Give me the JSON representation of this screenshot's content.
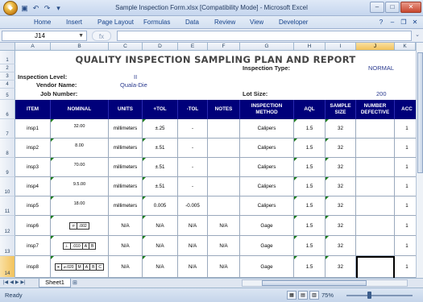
{
  "window": {
    "title": "Sample Inspection Form.xlsx  [Compatibility Mode] - Microsoft Excel"
  },
  "ribbon": {
    "tabs": [
      "Home",
      "Insert",
      "Page Layout",
      "Formulas",
      "Data",
      "Review",
      "View",
      "Developer"
    ]
  },
  "formula_bar": {
    "name_box": "J14",
    "fx": "fx",
    "content": ""
  },
  "columns": [
    "A",
    "B",
    "C",
    "D",
    "E",
    "F",
    "G",
    "H",
    "I",
    "J",
    "K"
  ],
  "selected_column": "J",
  "rows": [
    "1",
    "2",
    "3",
    "4",
    "5",
    "6",
    "7",
    "8",
    "9",
    "10",
    "11",
    "12",
    "13",
    "14"
  ],
  "form": {
    "title": "QUALITY INSPECTION SAMPLING PLAN AND REPORT",
    "inspection_type_label": "Inspection Type:",
    "inspection_type": "NORMAL",
    "inspection_level_label": "Inspection Level:",
    "inspection_level": "II",
    "vendor_name_label": "Vendor Name:",
    "vendor_name": "Quala-Die",
    "job_number_label": "Job Number:",
    "lot_size_label": "Lot Size:",
    "lot_size": "200"
  },
  "table": {
    "headers": [
      "ITEM",
      "NOMINAL",
      "UNITS",
      "+TOL",
      "-TOL",
      "NOTES",
      "INSPECTION METHOD",
      "AQL",
      "SAMPLE SIZE",
      "NUMBER DEFECTIVE",
      "ACC"
    ],
    "rows": [
      {
        "item": "insp1",
        "nominal": "32.00",
        "units": "millimeters",
        "ptol": "±.25",
        "mtol": "-",
        "notes": "",
        "method": "Calipers",
        "aql": "1.5",
        "sample": "32",
        "defective": "",
        "acc": "1"
      },
      {
        "item": "insp2",
        "nominal": "8.00",
        "units": "millimeters",
        "ptol": "±.51",
        "mtol": "-",
        "notes": "",
        "method": "Calipers",
        "aql": "1.5",
        "sample": "32",
        "defective": "",
        "acc": "1"
      },
      {
        "item": "insp3",
        "nominal": "70.00",
        "units": "millimeters",
        "ptol": "±.51",
        "mtol": "-",
        "notes": "",
        "method": "Calipers",
        "aql": "1.5",
        "sample": "32",
        "defective": "",
        "acc": "1"
      },
      {
        "item": "insp4",
        "nominal": "9.5.00",
        "units": "millimeters",
        "ptol": "±.51",
        "mtol": "-",
        "notes": "",
        "method": "Calipers",
        "aql": "1.5",
        "sample": "32",
        "defective": "",
        "acc": "1"
      },
      {
        "item": "insp5",
        "nominal": "18.00",
        "units": "millimeters",
        "ptol": "0.005",
        "mtol": "-0.005",
        "notes": "",
        "method": "Calipers",
        "aql": "1.5",
        "sample": "32",
        "defective": "",
        "acc": "1"
      },
      {
        "item": "insp6",
        "nominal": "",
        "units": "N/A",
        "ptol": "N/A",
        "mtol": "N/A",
        "notes": "N/A",
        "method": "Gage",
        "aql": "1.5",
        "sample": "32",
        "defective": "",
        "acc": "1"
      },
      {
        "item": "insp7",
        "nominal": "",
        "units": "N/A",
        "ptol": "N/A",
        "mtol": "N/A",
        "notes": "N/A",
        "method": "Gage",
        "aql": "1.5",
        "sample": "32",
        "defective": "",
        "acc": "1"
      },
      {
        "item": "insp8",
        "nominal": "",
        "units": "N/A",
        "ptol": "N/A",
        "mtol": "N/A",
        "notes": "N/A",
        "method": "Gage",
        "aql": "1.5",
        "sample": "32",
        "defective": "",
        "acc": "1"
      }
    ],
    "gdt": {
      "insp6": [
        "⌭",
        ".002"
      ],
      "insp7": [
        "⊥",
        ".010",
        "A",
        "B"
      ],
      "insp8": [
        "⌖",
        "⌀.020",
        "M",
        "A",
        "B",
        "C"
      ]
    }
  },
  "sheet": {
    "tab": "Sheet1"
  },
  "status": {
    "text": "Ready",
    "zoom": "75%"
  }
}
